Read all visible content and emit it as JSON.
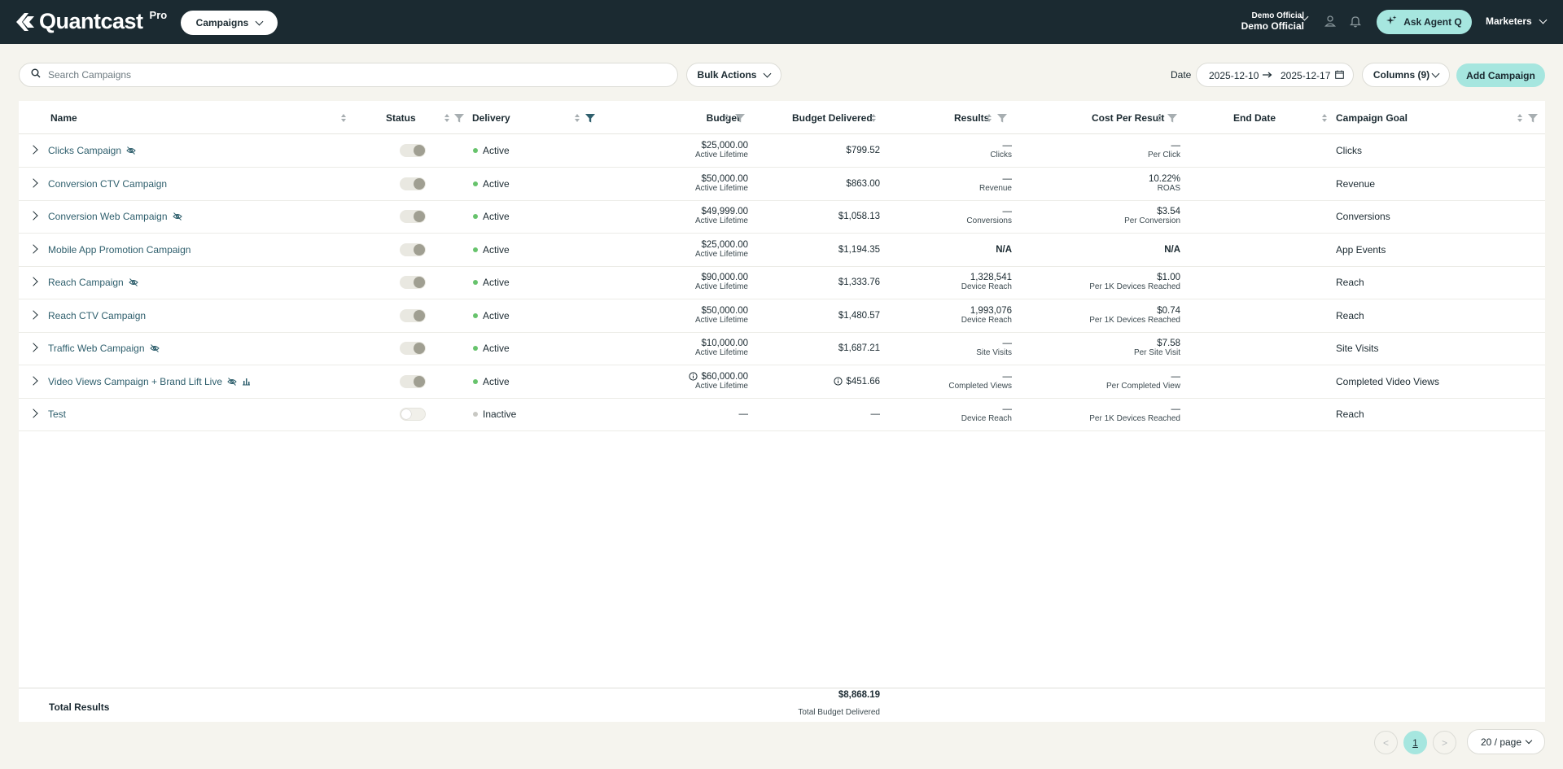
{
  "nav": {
    "brand": "Quantcast",
    "brand_tier": "Pro",
    "section_dropdown": "Campaigns",
    "account_org": "Demo Official",
    "account_name": "Demo Official",
    "ask_agent": "Ask Agent Q",
    "workspace": "Marketers"
  },
  "toolbar": {
    "search_placeholder": "Search Campaigns",
    "bulk_actions": "Bulk Actions",
    "date_label": "Date",
    "date_start": "2025-12-10",
    "date_end": "2025-12-17",
    "columns_button": "Columns (9)",
    "add_campaign": "Add Campaign"
  },
  "table": {
    "columns": {
      "name": "Name",
      "status": "Status",
      "delivery": "Delivery",
      "budget": "Budget",
      "budget_delivered": "Budget Delivered",
      "results": "Results",
      "cost_per_result": "Cost Per Result",
      "end_date": "End Date",
      "campaign_goal": "Campaign Goal"
    },
    "rows": [
      {
        "name": "Clicks Campaign",
        "hidden_icon": true,
        "chart_icon": false,
        "status_on": true,
        "delivery": "Active",
        "budget": "$25,000.00",
        "budget_sub": "Active Lifetime",
        "budget_info": false,
        "delivered": "$799.52",
        "delivered_info": false,
        "results": "—",
        "results_sub": "Clicks",
        "cpr": "—",
        "cpr_sub": "Per Click",
        "goal": "Clicks"
      },
      {
        "name": "Conversion CTV Campaign",
        "hidden_icon": false,
        "chart_icon": false,
        "status_on": true,
        "delivery": "Active",
        "budget": "$50,000.00",
        "budget_sub": "Active Lifetime",
        "budget_info": false,
        "delivered": "$863.00",
        "delivered_info": false,
        "results": "—",
        "results_sub": "Revenue",
        "cpr": "10.22%",
        "cpr_sub": "ROAS",
        "goal": "Revenue"
      },
      {
        "name": "Conversion Web Campaign",
        "hidden_icon": true,
        "chart_icon": false,
        "status_on": true,
        "delivery": "Active",
        "budget": "$49,999.00",
        "budget_sub": "Active Lifetime",
        "budget_info": false,
        "delivered": "$1,058.13",
        "delivered_info": false,
        "results": "—",
        "results_sub": "Conversions",
        "cpr": "$3.54",
        "cpr_sub": "Per Conversion",
        "goal": "Conversions"
      },
      {
        "name": "Mobile App Promotion Campaign",
        "hidden_icon": false,
        "chart_icon": false,
        "status_on": true,
        "delivery": "Active",
        "budget": "$25,000.00",
        "budget_sub": "Active Lifetime",
        "budget_info": false,
        "delivered": "$1,194.35",
        "delivered_info": false,
        "results": "N/A",
        "results_sub": "",
        "cpr": "N/A",
        "cpr_sub": "",
        "goal": "App Events"
      },
      {
        "name": "Reach Campaign",
        "hidden_icon": true,
        "chart_icon": false,
        "status_on": true,
        "delivery": "Active",
        "budget": "$90,000.00",
        "budget_sub": "Active Lifetime",
        "budget_info": false,
        "delivered": "$1,333.76",
        "delivered_info": false,
        "results": "1,328,541",
        "results_sub": "Device Reach",
        "cpr": "$1.00",
        "cpr_sub": "Per 1K Devices Reached",
        "goal": "Reach"
      },
      {
        "name": "Reach CTV Campaign",
        "hidden_icon": false,
        "chart_icon": false,
        "status_on": true,
        "delivery": "Active",
        "budget": "$50,000.00",
        "budget_sub": "Active Lifetime",
        "budget_info": false,
        "delivered": "$1,480.57",
        "delivered_info": false,
        "results": "1,993,076",
        "results_sub": "Device Reach",
        "cpr": "$0.74",
        "cpr_sub": "Per 1K Devices Reached",
        "goal": "Reach"
      },
      {
        "name": "Traffic Web Campaign",
        "hidden_icon": true,
        "chart_icon": false,
        "status_on": true,
        "delivery": "Active",
        "budget": "$10,000.00",
        "budget_sub": "Active Lifetime",
        "budget_info": false,
        "delivered": "$1,687.21",
        "delivered_info": false,
        "results": "—",
        "results_sub": "Site Visits",
        "cpr": "$7.58",
        "cpr_sub": "Per Site Visit",
        "goal": "Site Visits"
      },
      {
        "name": "Video Views Campaign + Brand Lift Live",
        "hidden_icon": true,
        "chart_icon": true,
        "status_on": true,
        "delivery": "Active",
        "budget": "$60,000.00",
        "budget_sub": "Active Lifetime",
        "budget_info": true,
        "delivered": "$451.66",
        "delivered_info": true,
        "results": "—",
        "results_sub": "Completed Views",
        "cpr": "—",
        "cpr_sub": "Per Completed View",
        "goal": "Completed Video Views"
      },
      {
        "name": "Test",
        "hidden_icon": false,
        "chart_icon": false,
        "status_on": false,
        "delivery": "Inactive",
        "budget": "—",
        "budget_sub": "",
        "budget_info": false,
        "delivered": "—",
        "delivered_info": false,
        "results": "—",
        "results_sub": "Device Reach",
        "cpr": "—",
        "cpr_sub": "Per 1K Devices Reached",
        "goal": "Reach"
      }
    ],
    "totals": {
      "label": "Total Results",
      "delivered": "$8,868.19",
      "delivered_sub": "Total Budget Delivered"
    }
  },
  "pagination": {
    "prev": "<",
    "current": "1",
    "next": ">",
    "page_size": "20 / page"
  },
  "colors": {
    "nav_bg": "#1b2a31",
    "accent": "#a6e6df",
    "page_bg": "#f5f4ee",
    "link": "#2f5f6d",
    "active_dot": "#67c36c"
  }
}
